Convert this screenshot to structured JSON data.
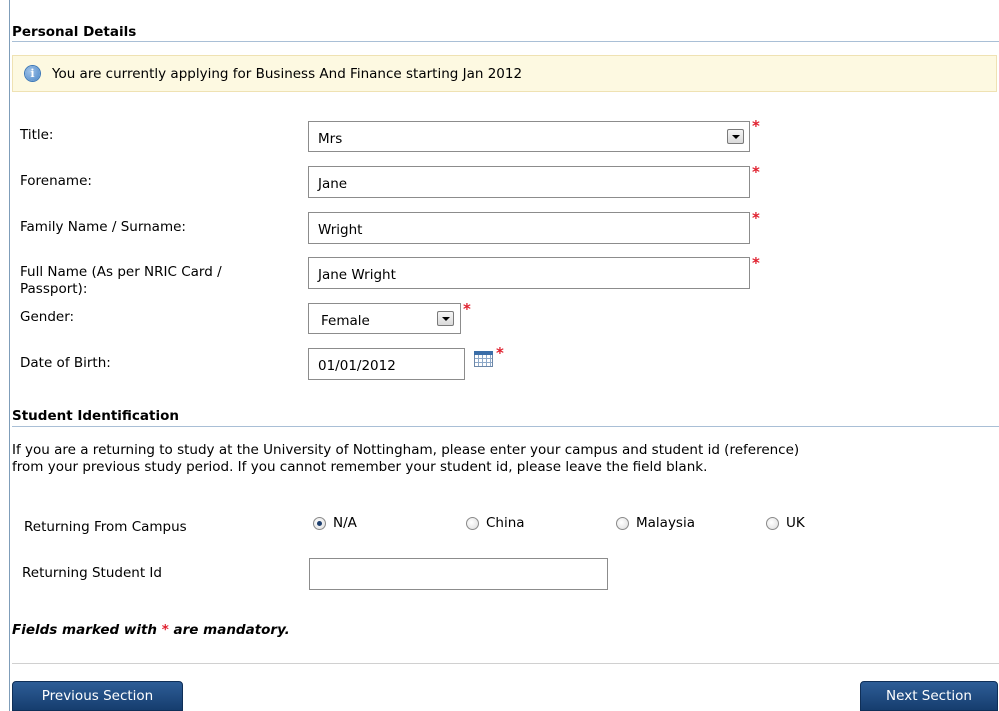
{
  "personal": {
    "heading": "Personal Details",
    "info": "You are currently applying for Business And Finance starting Jan 2012",
    "title_label": "Title:",
    "title_value": "Mrs",
    "forename_label": "Forename:",
    "forename_value": "Jane",
    "surname_label": "Family Name / Surname:",
    "surname_value": "Wright",
    "fullname_label_line1": "Full Name (As per NRIC Card /",
    "fullname_label_line2": "Passport):",
    "fullname_value": "Jane Wright",
    "gender_label": "Gender:",
    "gender_value": "Female",
    "dob_label": "Date of Birth:",
    "dob_value": "01/01/2012",
    "required_marker": "*"
  },
  "student": {
    "heading": "Student Identification",
    "para_line1": "If you are a returning to study at the University of Nottingham, please enter your campus and student id (reference)",
    "para_line2": "from your previous study period. If you cannot remember your student id, please leave the field blank.",
    "campus_label": "Returning From Campus",
    "campus_options": [
      "N/A",
      "China",
      "Malaysia",
      "UK"
    ],
    "campus_selected": "N/A",
    "id_label": "Returning Student Id",
    "id_value": ""
  },
  "footer": {
    "mandatory_prefix": "Fields marked with ",
    "mandatory_star": "*",
    "mandatory_suffix": " are mandatory.",
    "prev_label": "Previous Section",
    "next_label": "Next Section"
  },
  "icons": {
    "info": "info-icon",
    "calendar": "calendar-icon",
    "dropdown": "chevron-down-icon"
  }
}
